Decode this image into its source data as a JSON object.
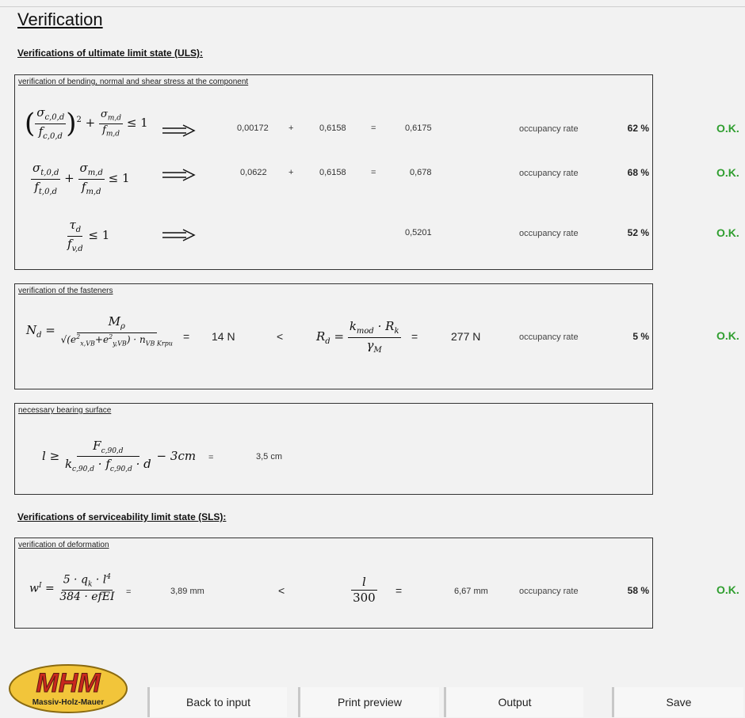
{
  "page": {
    "title": "Verification"
  },
  "uls": {
    "heading": "Verifications of ultimate limit state (ULS):",
    "box1": {
      "label": "verification of bending, normal and shear stress at the component",
      "rows": [
        {
          "a": "0,00172",
          "op": "+",
          "b": "0,6158",
          "eq": "=",
          "result": "0,6175",
          "rate_label": "occupancy rate",
          "rate": "62 %",
          "status": "O.K."
        },
        {
          "a": "0,0622",
          "op": "+",
          "b": "0,6158",
          "eq": "=",
          "result": "0,678",
          "rate_label": "occupancy rate",
          "rate": "68 %",
          "status": "O.K."
        },
        {
          "result": "0,5201",
          "rate_label": "occupancy rate",
          "rate": "52 %",
          "status": "O.K."
        }
      ]
    },
    "box2": {
      "label": "verification of the fasteners",
      "eq1": "=",
      "nd_value": "14 N",
      "lt": "<",
      "eq2": "=",
      "rd_value": "277 N",
      "rate_label": "occupancy rate",
      "rate": "5 %",
      "status": "O.K."
    },
    "box3": {
      "label": "necessary bearing surface",
      "eq": "=",
      "value": "3,5 cm"
    }
  },
  "sls": {
    "heading": "Verifications of serviceability limit state (SLS):",
    "box4": {
      "label": "verification of deformation",
      "eq1": "=",
      "w_value": "3,89 mm",
      "lt": "<",
      "eq2": "=",
      "limit_value": "6,67 mm",
      "rate_label": "occupancy rate",
      "rate": "58 %",
      "status": "O.K."
    }
  },
  "logo": {
    "text": "MHM",
    "subtext": "Massiv-Holz-Mauer"
  },
  "buttons": {
    "back": "Back to input",
    "print": "Print preview",
    "output": "Output",
    "save": "Save"
  },
  "colors": {
    "ok": "#2f9e2f",
    "logo_fill": "#f2c53a",
    "logo_text": "#c8281e"
  },
  "icons": {
    "implies": "implies-arrow-icon"
  }
}
